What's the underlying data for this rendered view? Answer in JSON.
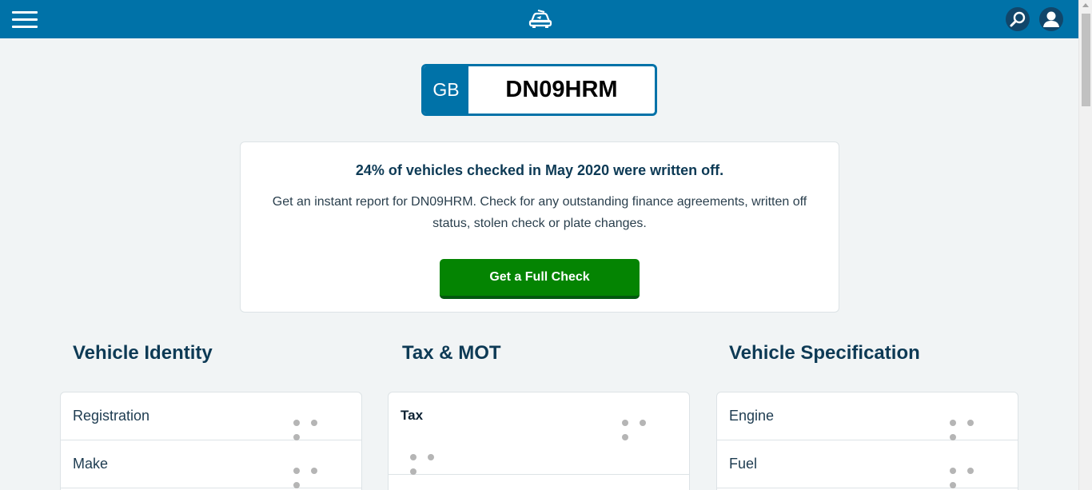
{
  "header": {
    "menu_icon": "hamburger-icon",
    "logo_icon": "car-logo-icon",
    "search_icon": "search-icon",
    "account_icon": "user-icon",
    "brand_color": "#0072a8"
  },
  "plate": {
    "country": "GB",
    "registration": "DN09HRM"
  },
  "promo": {
    "headline": "24% of vehicles checked in May 2020 were written off.",
    "body": "Get an instant report for DN09HRM. Check for any outstanding finance agreements, written off status, stolen check or plate changes.",
    "cta_label": "Get a Full Check",
    "cta_color": "#048402"
  },
  "sections": {
    "identity": {
      "title": "Vehicle Identity",
      "rows": [
        "Registration",
        "Make"
      ]
    },
    "tax_mot": {
      "title": "Tax & MOT",
      "rows": [
        "Tax"
      ]
    },
    "specification": {
      "title": "Vehicle Specification",
      "rows": [
        "Engine",
        "Fuel"
      ]
    }
  }
}
